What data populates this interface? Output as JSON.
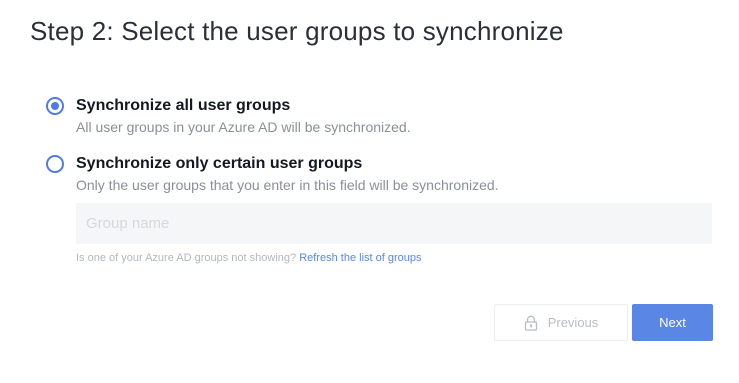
{
  "page": {
    "title": "Step 2: Select the user groups to synchronize"
  },
  "options": [
    {
      "label": "Synchronize all user groups",
      "description": "All user groups in your Azure AD will be synchronized.",
      "selected": true
    },
    {
      "label": "Synchronize only certain user groups",
      "description": "Only the user groups that you enter in this field will be synchronized.",
      "selected": false
    }
  ],
  "group_input": {
    "placeholder": "Group name",
    "value": ""
  },
  "hint": {
    "text": "Is one of your Azure AD groups not showing? ",
    "link": "Refresh the list of groups"
  },
  "buttons": {
    "previous": "Previous",
    "next": "Next"
  },
  "colors": {
    "accent": "#5a86e6",
    "radio": "#4f7ae8",
    "muted_text": "#8a8f99",
    "input_bg": "#f5f6f7"
  },
  "icons": {
    "previous_button_icon": "lock-icon"
  }
}
